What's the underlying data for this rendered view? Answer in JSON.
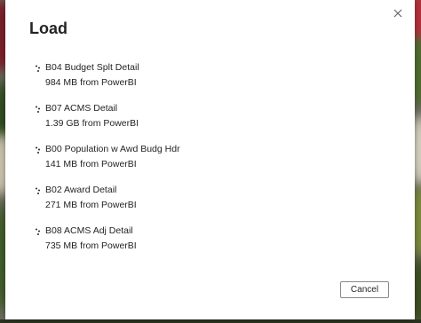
{
  "dialog": {
    "title": "Load",
    "close_icon": "close-icon",
    "items": [
      {
        "name": "B04 Budget Splt Detail",
        "meta": "984 MB from PowerBI"
      },
      {
        "name": "B07 ACMS Detail",
        "meta": "1.39 GB from PowerBI"
      },
      {
        "name": "B00 Population w Awd Budg Hdr",
        "meta": "141 MB from PowerBI"
      },
      {
        "name": "B02 Award Detail",
        "meta": "271 MB from PowerBI"
      },
      {
        "name": "B08 ACMS Adj Detail",
        "meta": "735 MB from PowerBI"
      }
    ],
    "item_icon": "loading-spinner-icon",
    "cancel_label": "Cancel"
  }
}
